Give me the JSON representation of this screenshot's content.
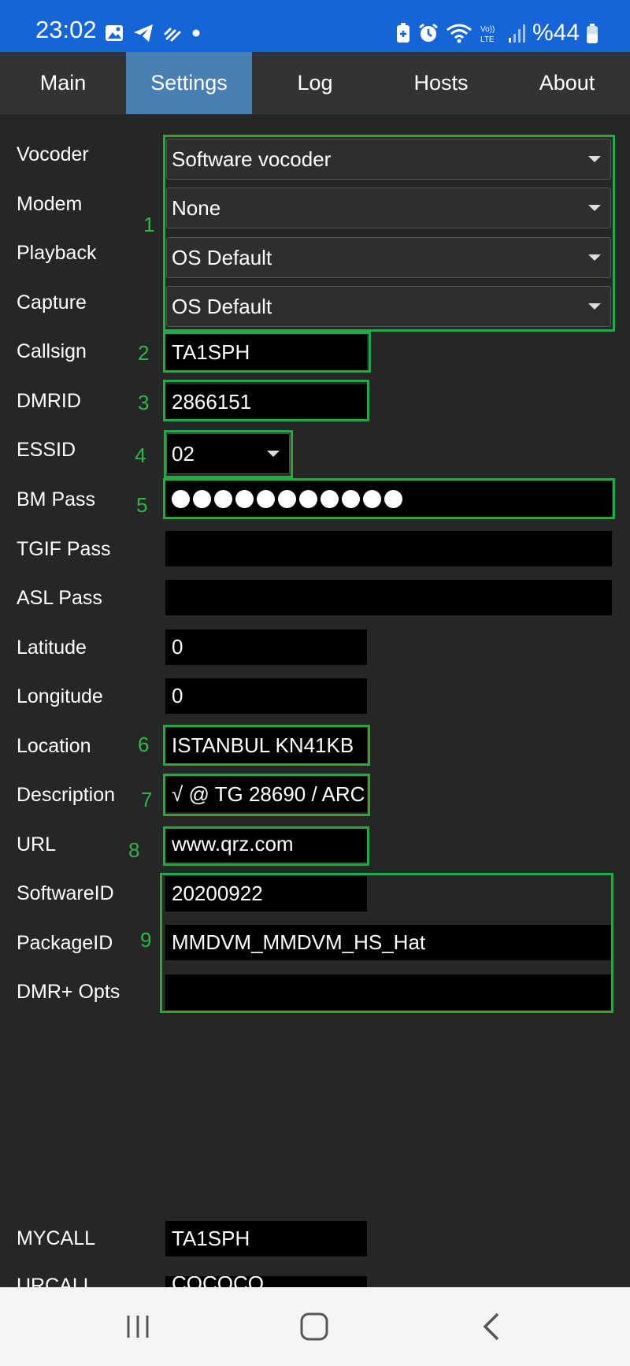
{
  "status_bar": {
    "time": "23:02",
    "battery_text": "%44",
    "left_icons": [
      "image-icon",
      "telegram-icon",
      "app-icon",
      "dot-icon"
    ],
    "right_icons": [
      "battery-saver-icon",
      "alarm-icon",
      "wifi-icon",
      "volte-icon",
      "signal-icon",
      "battery-icon"
    ]
  },
  "tabs": [
    {
      "label": "Main",
      "active": false
    },
    {
      "label": "Settings",
      "active": true
    },
    {
      "label": "Log",
      "active": false
    },
    {
      "label": "Hosts",
      "active": false
    },
    {
      "label": "About",
      "active": false
    }
  ],
  "settings": {
    "vocoder": {
      "label": "Vocoder",
      "value": "Software vocoder"
    },
    "modem": {
      "label": "Modem",
      "value": "None"
    },
    "playback": {
      "label": "Playback",
      "value": "OS Default"
    },
    "capture": {
      "label": "Capture",
      "value": "OS Default"
    },
    "callsign": {
      "label": "Callsign",
      "value": "TA1SPH"
    },
    "dmrid": {
      "label": "DMRID",
      "value": "2866151"
    },
    "essid": {
      "label": "ESSID",
      "value": "02"
    },
    "bm_pass": {
      "label": "BM Pass",
      "masked_length": 11
    },
    "tgif_pass": {
      "label": "TGIF Pass",
      "value": ""
    },
    "asl_pass": {
      "label": "ASL Pass",
      "value": ""
    },
    "latitude": {
      "label": "Latitude",
      "value": "0"
    },
    "longitude": {
      "label": "Longitude",
      "value": "0"
    },
    "location": {
      "label": "Location",
      "value": "ISTANBUL KN41KB"
    },
    "description": {
      "label": "Description",
      "value": "√ @ TG 28690 / ARC"
    },
    "url": {
      "label": "URL",
      "value": "www.qrz.com"
    },
    "software_id": {
      "label": "SoftwareID",
      "value": "20200922"
    },
    "package_id": {
      "label": "PackageID",
      "value": "MMDVM_MMDVM_HS_Hat"
    },
    "dmr_opts": {
      "label": "DMR+ Opts",
      "value": ""
    },
    "mycall": {
      "label": "MYCALL",
      "value": "TA1SPH"
    },
    "urcall": {
      "label": "URCALL",
      "value": "CQCQCQ"
    }
  },
  "annotations": [
    "1",
    "2",
    "3",
    "4",
    "5",
    "6",
    "7",
    "8",
    "9"
  ],
  "annotation_color": "#27a844",
  "nav_bar": {
    "buttons": [
      "recents-icon",
      "home-icon",
      "back-icon"
    ]
  }
}
